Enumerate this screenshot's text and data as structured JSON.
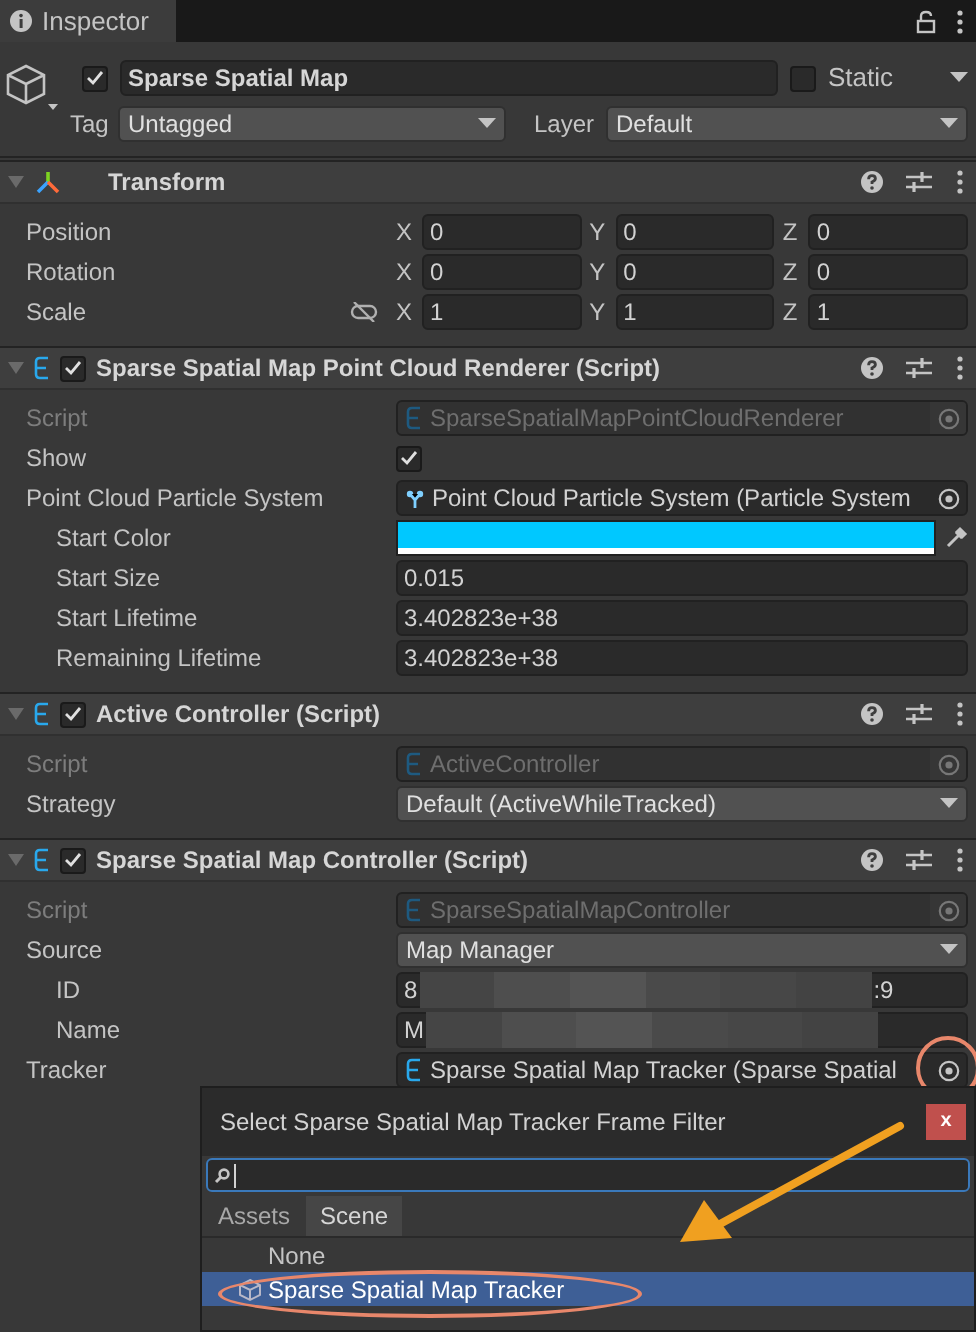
{
  "tab": {
    "label": "Inspector"
  },
  "object": {
    "enabled": true,
    "name": "Sparse Spatial Map",
    "static": false,
    "static_label": "Static",
    "tag_label": "Tag",
    "tag": "Untagged",
    "layer_label": "Layer",
    "layer": "Default"
  },
  "components": [
    {
      "kind": "transform",
      "title": "Transform",
      "rows": [
        {
          "kind": "vector3",
          "label": "Position",
          "fields": [
            {
              "axis": "X",
              "value": "0"
            },
            {
              "axis": "Y",
              "value": "0"
            },
            {
              "axis": "Z",
              "value": "0"
            }
          ]
        },
        {
          "kind": "vector3",
          "label": "Rotation",
          "fields": [
            {
              "axis": "X",
              "value": "0"
            },
            {
              "axis": "Y",
              "value": "0"
            },
            {
              "axis": "Z",
              "value": "0"
            }
          ]
        },
        {
          "kind": "vector3",
          "label": "Scale",
          "constrained": false,
          "fields": [
            {
              "axis": "X",
              "value": "1"
            },
            {
              "axis": "Y",
              "value": "1"
            },
            {
              "axis": "Z",
              "value": "1"
            }
          ]
        }
      ]
    },
    {
      "kind": "script",
      "title": "Sparse Spatial Map Point Cloud Renderer (Script)",
      "enabled": true,
      "rows": [
        {
          "kind": "script",
          "label": "Script",
          "value": "SparseSpatialMapPointCloudRenderer",
          "disabled": true
        },
        {
          "kind": "checkbox",
          "label": "Show",
          "checked": true
        },
        {
          "kind": "particles",
          "label": "Point Cloud Particle System",
          "value": "Point Cloud Particle System (Particle System",
          "disabled": false,
          "children": [
            {
              "kind": "color",
              "label": "Start Color",
              "color": "#00c8ff"
            },
            {
              "kind": "text",
              "label": "Start Size",
              "value": "0.015"
            },
            {
              "kind": "text",
              "label": "Start Lifetime",
              "value": "3.402823e+38"
            },
            {
              "kind": "text",
              "label": "Remaining Lifetime",
              "value": "3.402823e+38"
            }
          ]
        }
      ]
    },
    {
      "kind": "script",
      "title": "Active Controller (Script)",
      "enabled": true,
      "rows": [
        {
          "kind": "script",
          "label": "Script",
          "value": "ActiveController",
          "disabled": true
        },
        {
          "kind": "dropdown",
          "label": "Strategy",
          "value": "Default (ActiveWhileTracked)"
        }
      ]
    },
    {
      "kind": "script",
      "title": "Sparse Spatial Map Controller (Script)",
      "enabled": true,
      "rows": [
        {
          "kind": "script",
          "label": "Script",
          "value": "SparseSpatialMapController",
          "disabled": true
        },
        {
          "kind": "dropdown",
          "label": "Source",
          "value": "Map Manager",
          "children": [
            {
              "kind": "text",
              "label": "ID",
              "value": "8",
              "value_end": ":9",
              "redacted": true
            },
            {
              "kind": "text",
              "label": "Name",
              "value": "M",
              "redacted": true
            }
          ]
        },
        {
          "kind": "tracker",
          "label": "Tracker",
          "value": "Sparse Spatial Map Tracker (Sparse Spatial",
          "disabled": false,
          "highlighted": true
        }
      ]
    }
  ],
  "popup": {
    "title": "Select Sparse Spatial Map Tracker Frame Filter",
    "close": "x",
    "tabs": [
      {
        "label": "Assets",
        "selected": false
      },
      {
        "label": "Scene",
        "selected": true
      }
    ],
    "items": [
      {
        "kind": "none",
        "label": "None",
        "selected": false,
        "highlighted": false
      },
      {
        "kind": "gameobject",
        "label": "Sparse Spatial Map Tracker",
        "selected": true,
        "highlighted": true
      }
    ]
  },
  "annotation_arrow": true
}
